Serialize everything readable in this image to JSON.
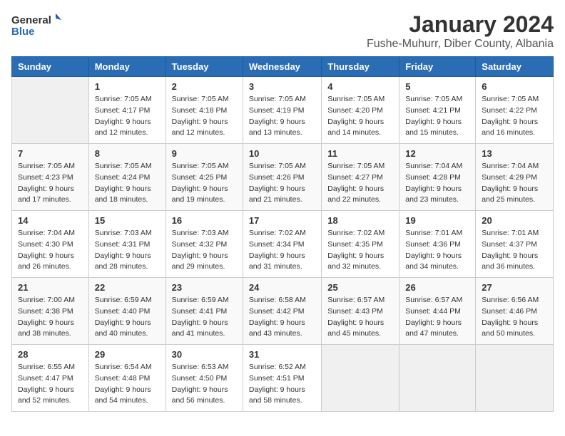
{
  "logo": {
    "general": "General",
    "blue": "Blue"
  },
  "title": "January 2024",
  "location": "Fushe-Muhurr, Diber County, Albania",
  "headers": [
    "Sunday",
    "Monday",
    "Tuesday",
    "Wednesday",
    "Thursday",
    "Friday",
    "Saturday"
  ],
  "weeks": [
    [
      {
        "day": "",
        "data": null
      },
      {
        "day": "1",
        "sunrise": "7:05 AM",
        "sunset": "4:17 PM",
        "daylight": "9 hours and 12 minutes."
      },
      {
        "day": "2",
        "sunrise": "7:05 AM",
        "sunset": "4:18 PM",
        "daylight": "9 hours and 12 minutes."
      },
      {
        "day": "3",
        "sunrise": "7:05 AM",
        "sunset": "4:19 PM",
        "daylight": "9 hours and 13 minutes."
      },
      {
        "day": "4",
        "sunrise": "7:05 AM",
        "sunset": "4:20 PM",
        "daylight": "9 hours and 14 minutes."
      },
      {
        "day": "5",
        "sunrise": "7:05 AM",
        "sunset": "4:21 PM",
        "daylight": "9 hours and 15 minutes."
      },
      {
        "day": "6",
        "sunrise": "7:05 AM",
        "sunset": "4:22 PM",
        "daylight": "9 hours and 16 minutes."
      }
    ],
    [
      {
        "day": "7",
        "sunrise": "7:05 AM",
        "sunset": "4:23 PM",
        "daylight": "9 hours and 17 minutes."
      },
      {
        "day": "8",
        "sunrise": "7:05 AM",
        "sunset": "4:24 PM",
        "daylight": "9 hours and 18 minutes."
      },
      {
        "day": "9",
        "sunrise": "7:05 AM",
        "sunset": "4:25 PM",
        "daylight": "9 hours and 19 minutes."
      },
      {
        "day": "10",
        "sunrise": "7:05 AM",
        "sunset": "4:26 PM",
        "daylight": "9 hours and 21 minutes."
      },
      {
        "day": "11",
        "sunrise": "7:05 AM",
        "sunset": "4:27 PM",
        "daylight": "9 hours and 22 minutes."
      },
      {
        "day": "12",
        "sunrise": "7:04 AM",
        "sunset": "4:28 PM",
        "daylight": "9 hours and 23 minutes."
      },
      {
        "day": "13",
        "sunrise": "7:04 AM",
        "sunset": "4:29 PM",
        "daylight": "9 hours and 25 minutes."
      }
    ],
    [
      {
        "day": "14",
        "sunrise": "7:04 AM",
        "sunset": "4:30 PM",
        "daylight": "9 hours and 26 minutes."
      },
      {
        "day": "15",
        "sunrise": "7:03 AM",
        "sunset": "4:31 PM",
        "daylight": "9 hours and 28 minutes."
      },
      {
        "day": "16",
        "sunrise": "7:03 AM",
        "sunset": "4:32 PM",
        "daylight": "9 hours and 29 minutes."
      },
      {
        "day": "17",
        "sunrise": "7:02 AM",
        "sunset": "4:34 PM",
        "daylight": "9 hours and 31 minutes."
      },
      {
        "day": "18",
        "sunrise": "7:02 AM",
        "sunset": "4:35 PM",
        "daylight": "9 hours and 32 minutes."
      },
      {
        "day": "19",
        "sunrise": "7:01 AM",
        "sunset": "4:36 PM",
        "daylight": "9 hours and 34 minutes."
      },
      {
        "day": "20",
        "sunrise": "7:01 AM",
        "sunset": "4:37 PM",
        "daylight": "9 hours and 36 minutes."
      }
    ],
    [
      {
        "day": "21",
        "sunrise": "7:00 AM",
        "sunset": "4:38 PM",
        "daylight": "9 hours and 38 minutes."
      },
      {
        "day": "22",
        "sunrise": "6:59 AM",
        "sunset": "4:40 PM",
        "daylight": "9 hours and 40 minutes."
      },
      {
        "day": "23",
        "sunrise": "6:59 AM",
        "sunset": "4:41 PM",
        "daylight": "9 hours and 41 minutes."
      },
      {
        "day": "24",
        "sunrise": "6:58 AM",
        "sunset": "4:42 PM",
        "daylight": "9 hours and 43 minutes."
      },
      {
        "day": "25",
        "sunrise": "6:57 AM",
        "sunset": "4:43 PM",
        "daylight": "9 hours and 45 minutes."
      },
      {
        "day": "26",
        "sunrise": "6:57 AM",
        "sunset": "4:44 PM",
        "daylight": "9 hours and 47 minutes."
      },
      {
        "day": "27",
        "sunrise": "6:56 AM",
        "sunset": "4:46 PM",
        "daylight": "9 hours and 50 minutes."
      }
    ],
    [
      {
        "day": "28",
        "sunrise": "6:55 AM",
        "sunset": "4:47 PM",
        "daylight": "9 hours and 52 minutes."
      },
      {
        "day": "29",
        "sunrise": "6:54 AM",
        "sunset": "4:48 PM",
        "daylight": "9 hours and 54 minutes."
      },
      {
        "day": "30",
        "sunrise": "6:53 AM",
        "sunset": "4:50 PM",
        "daylight": "9 hours and 56 minutes."
      },
      {
        "day": "31",
        "sunrise": "6:52 AM",
        "sunset": "4:51 PM",
        "daylight": "9 hours and 58 minutes."
      },
      {
        "day": "",
        "data": null
      },
      {
        "day": "",
        "data": null
      },
      {
        "day": "",
        "data": null
      }
    ]
  ]
}
